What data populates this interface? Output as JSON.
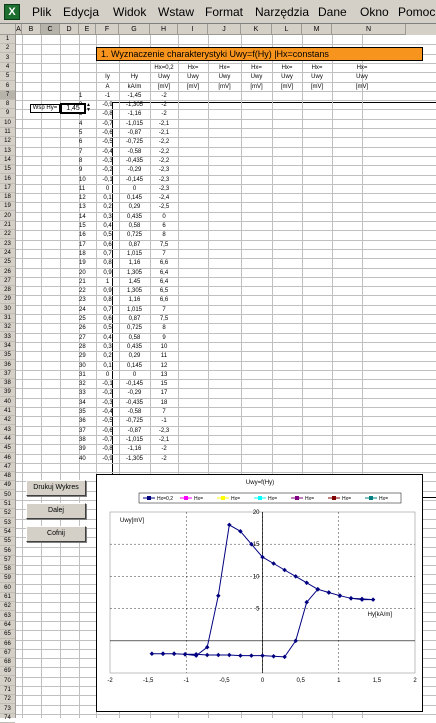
{
  "menu": [
    "Plik",
    "Edycja",
    "Widok",
    "Wstaw",
    "Format",
    "Narzędzia",
    "Dane",
    "Okno",
    "Pomoc"
  ],
  "columns": [
    "A",
    "B",
    "C",
    "D",
    "E",
    "F",
    "G",
    "H",
    "I",
    "J",
    "K",
    "L",
    "M",
    "N"
  ],
  "rows_start": 1,
  "rows_count": 74,
  "sheet_title": "1. Wyznaczenie charakterystyki Uwy=f(Hy) |Hx=constans",
  "hx_headers": [
    "Hx=0,2",
    "Hx=",
    "Hx=",
    "Hx=",
    "Hx=",
    "Hx=",
    "Hx="
  ],
  "subheader1": [
    "Iy",
    "Hy",
    "Uwy",
    "Uwy",
    "Uwy",
    "Uwy",
    "Uwy",
    "Uwy",
    "Uwy"
  ],
  "subheader2": [
    "A",
    "kA/m",
    "[mV]",
    "[mV]",
    "[mV]",
    "[mV]",
    "[mV]",
    "[mV]",
    "[mV]"
  ],
  "input_label": "Wsp Hy=",
  "input_value": "1,45",
  "data_rows": [
    [
      "1",
      "-1",
      "-1,45",
      "-2"
    ],
    [
      "2",
      "-0,9",
      "-1,305",
      "-2"
    ],
    [
      "3",
      "-0,8",
      "-1,16",
      "-2"
    ],
    [
      "4",
      "-0,7",
      "-1,015",
      "-2,1"
    ],
    [
      "5",
      "-0,6",
      "-0,87",
      "-2,1"
    ],
    [
      "6",
      "-0,5",
      "-0,725",
      "-2,2"
    ],
    [
      "7",
      "-0,4",
      "-0,58",
      "-2,2"
    ],
    [
      "8",
      "-0,3",
      "-0,435",
      "-2,2"
    ],
    [
      "9",
      "-0,2",
      "-0,29",
      "-2,3"
    ],
    [
      "10",
      "-0,1",
      "-0,145",
      "-2,3"
    ],
    [
      "11",
      "0",
      "0",
      "-2,3"
    ],
    [
      "12",
      "0,1",
      "0,145",
      "-2,4"
    ],
    [
      "13",
      "0,2",
      "0,29",
      "-2,5"
    ],
    [
      "14",
      "0,3",
      "0,435",
      "0"
    ],
    [
      "15",
      "0,4",
      "0,58",
      "6"
    ],
    [
      "16",
      "0,5",
      "0,725",
      "8"
    ],
    [
      "17",
      "0,6",
      "0,87",
      "7,5"
    ],
    [
      "18",
      "0,7",
      "1,015",
      "7"
    ],
    [
      "19",
      "0,8",
      "1,16",
      "6,6"
    ],
    [
      "20",
      "0,9",
      "1,305",
      "6,4"
    ],
    [
      "21",
      "1",
      "1,45",
      "6,4"
    ],
    [
      "22",
      "0,9",
      "1,305",
      "6,5"
    ],
    [
      "23",
      "0,8",
      "1,16",
      "6,6"
    ],
    [
      "24",
      "0,7",
      "1,015",
      "7"
    ],
    [
      "25",
      "0,6",
      "0,87",
      "7,5"
    ],
    [
      "26",
      "0,5",
      "0,725",
      "8"
    ],
    [
      "27",
      "0,4",
      "0,58",
      "9"
    ],
    [
      "28",
      "0,3",
      "0,435",
      "10"
    ],
    [
      "29",
      "0,2",
      "0,29",
      "11"
    ],
    [
      "30",
      "0,1",
      "0,145",
      "12"
    ],
    [
      "31",
      "0",
      "0",
      "13"
    ],
    [
      "32",
      "-0,1",
      "-0,145",
      "15"
    ],
    [
      "33",
      "-0,2",
      "-0,29",
      "17"
    ],
    [
      "34",
      "-0,3",
      "-0,435",
      "18"
    ],
    [
      "35",
      "-0,4",
      "-0,58",
      "7"
    ],
    [
      "36",
      "-0,5",
      "-0,725",
      "-1"
    ],
    [
      "37",
      "-0,6",
      "-0,87",
      "-2,3"
    ],
    [
      "38",
      "-0,7",
      "-1,015",
      "-2,1"
    ],
    [
      "39",
      "-0,8",
      "-1,16",
      "-2"
    ],
    [
      "40",
      "-0,9",
      "-1,305",
      "-2"
    ]
  ],
  "buttons": {
    "print": "Drukuj Wykres",
    "next": "Dalej",
    "back": "Cofnij"
  },
  "chart_data": {
    "type": "line",
    "title": "Uwy=f(Hy)",
    "ylabel": "Uwy[mV]",
    "xlabel": "Hy[kA/m]",
    "xlim": [
      -2,
      2
    ],
    "ylim": [
      -5,
      20
    ],
    "xticks": [
      "-2",
      "-1,5",
      "-1",
      "-0,5",
      "0",
      "0,5",
      "1",
      "1,5",
      "2"
    ],
    "yticks": [
      "20",
      "15",
      "10",
      "5"
    ],
    "legend": [
      "Hx=0,2",
      "Hx=",
      "Hx=",
      "Hx=",
      "Hx=",
      "Hx=",
      "Hx="
    ],
    "legend_colors": [
      "#000080",
      "#ff00ff",
      "#ffff00",
      "#00ffff",
      "#800080",
      "#800000",
      "#008080"
    ],
    "series": [
      {
        "name": "Hx=0,2",
        "x": [
          -1.45,
          -1.305,
          -1.16,
          -1.015,
          -0.87,
          -0.725,
          -0.58,
          -0.435,
          -0.29,
          -0.145,
          0,
          0.145,
          0.29,
          0.435,
          0.58,
          0.725,
          0.87,
          1.015,
          1.16,
          1.305,
          1.45,
          1.305,
          1.16,
          1.015,
          0.87,
          0.725,
          0.58,
          0.435,
          0.29,
          0.145,
          0,
          -0.145,
          -0.29,
          -0.435,
          -0.58,
          -0.725,
          -0.87,
          -1.015,
          -1.16,
          -1.305
        ],
        "y": [
          -2,
          -2,
          -2,
          -2.1,
          -2.1,
          -2.2,
          -2.2,
          -2.2,
          -2.3,
          -2.3,
          -2.3,
          -2.4,
          -2.5,
          0,
          6,
          8,
          7.5,
          7,
          6.6,
          6.4,
          6.4,
          6.5,
          6.6,
          7,
          7.5,
          8,
          9,
          10,
          11,
          12,
          13,
          15,
          17,
          18,
          7,
          -1,
          -2.3,
          -2.1,
          -2,
          -2
        ]
      }
    ]
  }
}
